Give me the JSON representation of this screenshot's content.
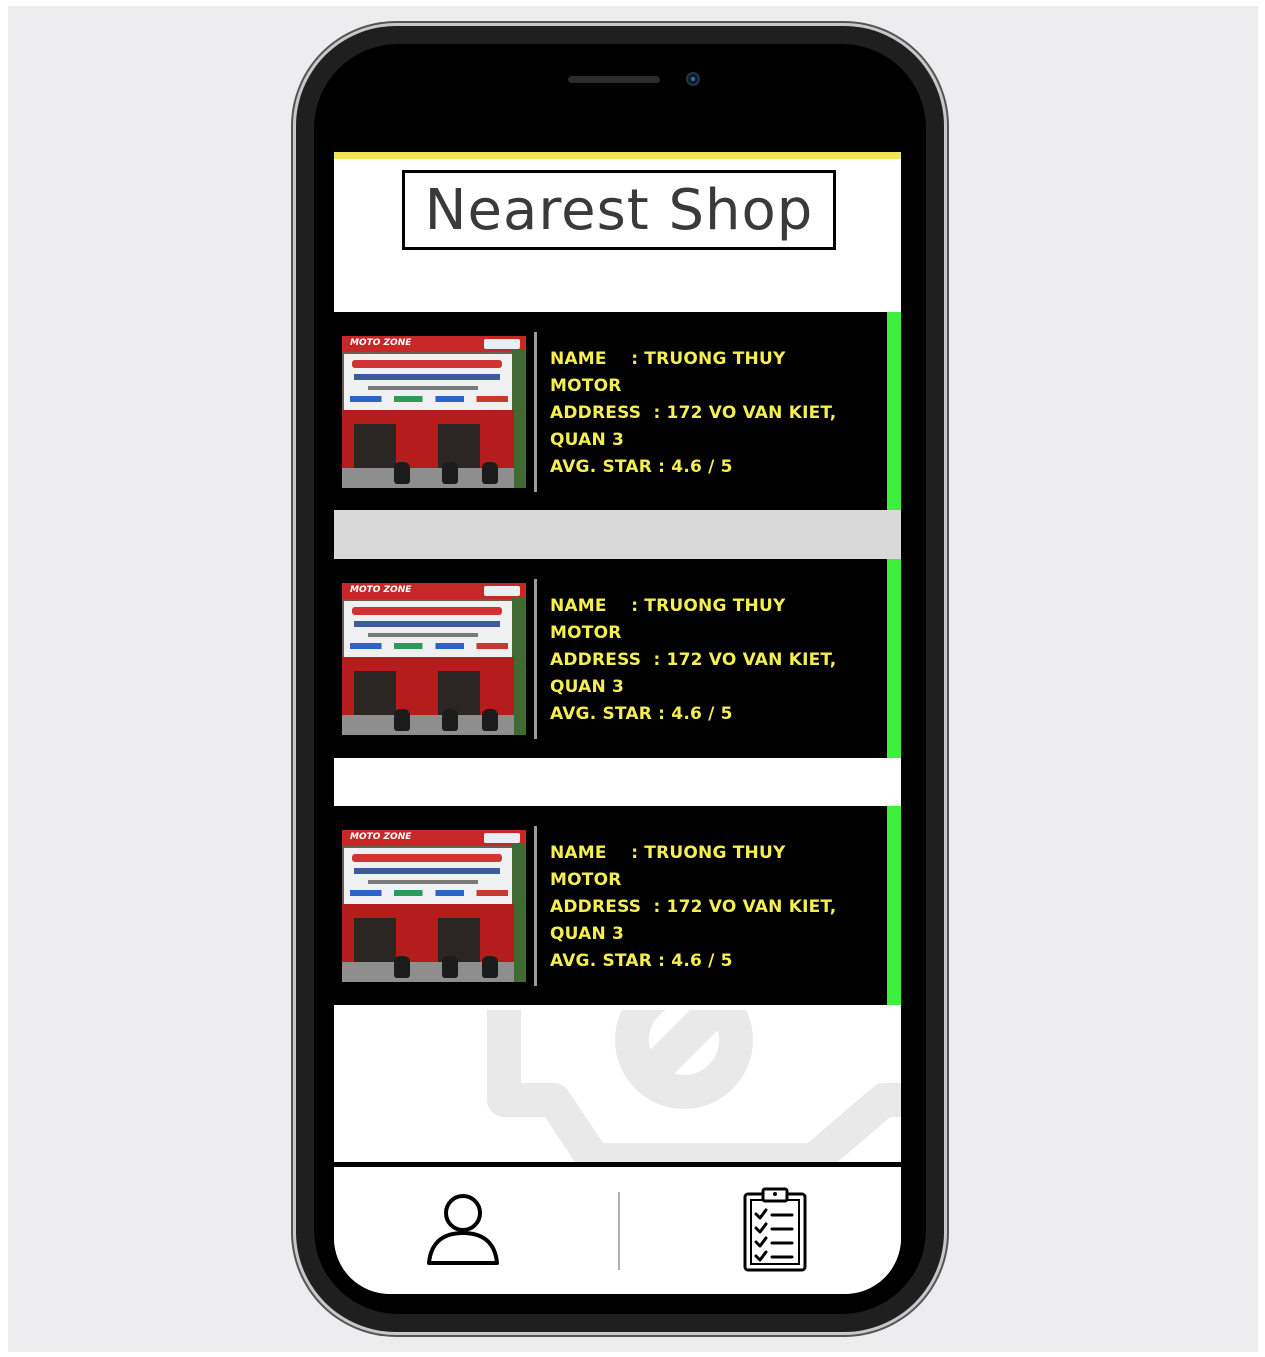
{
  "page": {
    "title": "Nearest Shop"
  },
  "shops": [
    {
      "thumb": {
        "brand": "MOTO ZONE"
      },
      "name_line": "NAME    : TRUONG THUY",
      "name_cont": "MOTOR",
      "address_line": "ADDRESS  : 172 VO VAN KIET,",
      "address_cont": "QUAN 3",
      "rating_line": "AVG. STAR : 4.6 / 5"
    },
    {
      "thumb": {
        "brand": "MOTO ZONE"
      },
      "name_line": "NAME    : TRUONG THUY",
      "name_cont": "MOTOR",
      "address_line": "ADDRESS  : 172 VO VAN KIET,",
      "address_cont": "QUAN 3",
      "rating_line": "AVG. STAR : 4.6 / 5"
    },
    {
      "thumb": {
        "brand": "MOTO ZONE"
      },
      "name_line": "NAME    : TRUONG THUY",
      "name_cont": "MOTOR",
      "address_line": "ADDRESS  : 172 VO VAN KIET,",
      "address_cont": "QUAN 3",
      "rating_line": "AVG. STAR : 4.6 / 5"
    }
  ],
  "bottom_nav": {
    "items": [
      {
        "icon": "user-icon"
      },
      {
        "icon": "clipboard-checklist-icon"
      }
    ]
  },
  "colors": {
    "accent_yellow": "#f3e45e",
    "card_text": "#f4ee52",
    "card_accent": "#3cf03c",
    "card_bg": "#000000"
  }
}
